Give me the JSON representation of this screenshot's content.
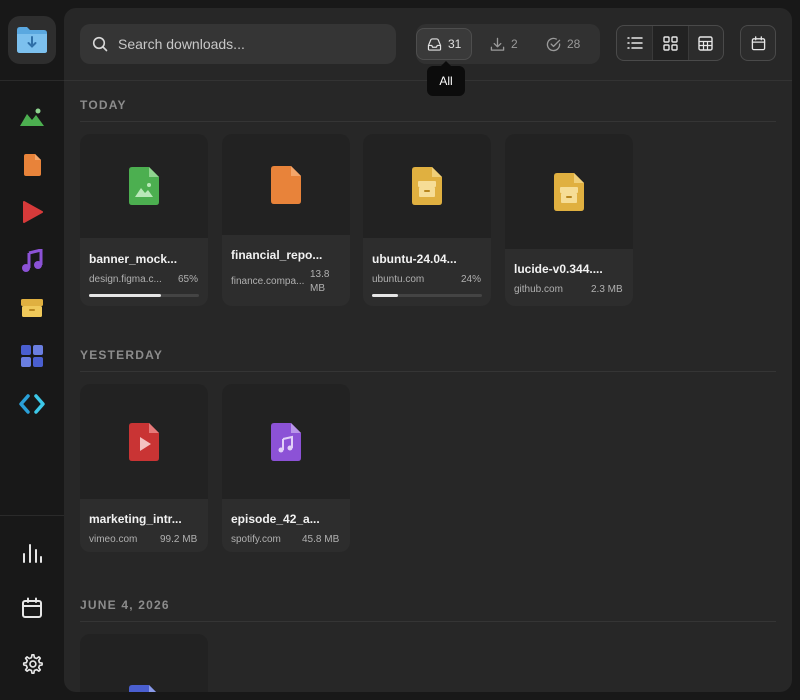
{
  "search": {
    "placeholder": "Search downloads..."
  },
  "filters": [
    {
      "label": "31",
      "icon": "inbox-icon",
      "tooltip": "All"
    },
    {
      "label": "2",
      "icon": "download-icon"
    },
    {
      "label": "28",
      "icon": "check-circle-icon"
    }
  ],
  "tooltip": "All",
  "sidebar": {
    "items": [
      {
        "name": "images",
        "icon": "image-icon",
        "color": "#4caf50"
      },
      {
        "name": "documents",
        "icon": "document-icon",
        "color": "#e8833a"
      },
      {
        "name": "videos",
        "icon": "video-icon",
        "color": "#d63a3a"
      },
      {
        "name": "audio",
        "icon": "music-icon",
        "color": "#8c52d6"
      },
      {
        "name": "archives",
        "icon": "archive-icon",
        "color": "#e0b040"
      },
      {
        "name": "apps",
        "icon": "apps-icon",
        "color": "#4a5fd0"
      },
      {
        "name": "code",
        "icon": "code-icon",
        "color": "#2aa0d8"
      }
    ],
    "bottom": [
      {
        "name": "stats",
        "icon": "bar-chart-icon"
      },
      {
        "name": "calendar",
        "icon": "calendar-icon"
      },
      {
        "name": "settings",
        "icon": "gear-icon"
      }
    ]
  },
  "sections": [
    {
      "title": "TODAY",
      "items": [
        {
          "name": "banner_mock...",
          "source": "design.figma.c...",
          "meta": "65%",
          "progress": 0.65,
          "type": "image",
          "color": "#4caf50"
        },
        {
          "name": "financial_repo...",
          "source": "finance.compa...",
          "meta": "13.8 MB",
          "type": "document",
          "color": "#e8833a"
        },
        {
          "name": "ubuntu-24.04...",
          "source": "ubuntu.com",
          "meta": "24%",
          "progress": 0.24,
          "type": "archive",
          "color": "#e0b040"
        },
        {
          "name": "lucide-v0.344....",
          "source": "github.com",
          "meta": "2.3 MB",
          "type": "archive",
          "color": "#e0b040"
        }
      ]
    },
    {
      "title": "YESTERDAY",
      "items": [
        {
          "name": "marketing_intr...",
          "source": "vimeo.com",
          "meta": "99.2 MB",
          "type": "video",
          "color": "#d63a3a"
        },
        {
          "name": "episode_42_a...",
          "source": "spotify.com",
          "meta": "45.8 MB",
          "type": "audio",
          "color": "#8c52d6"
        }
      ]
    },
    {
      "title": "JUNE 4, 2026",
      "items": [
        {
          "type": "app",
          "color": "#4a5fd0"
        }
      ]
    }
  ]
}
